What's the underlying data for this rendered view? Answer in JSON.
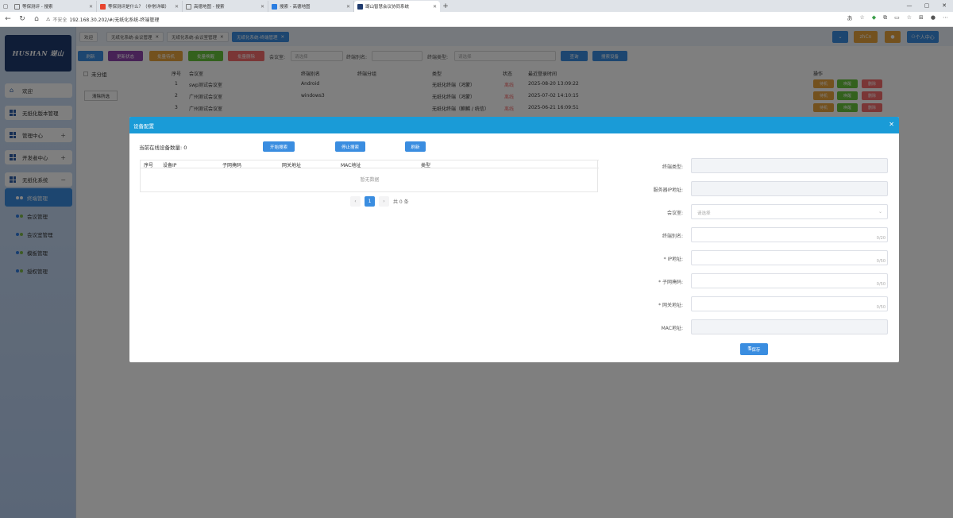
{
  "browser": {
    "tabs": [
      {
        "title": "等保测评 - 搜索"
      },
      {
        "title": "等保测评是什么？（非常详细）"
      },
      {
        "title": "高德地图 - 搜索"
      },
      {
        "title": "搜索 - 高德地图"
      },
      {
        "title": "瑚山智慧会议协同系统"
      }
    ],
    "insecure_label": "不安全",
    "url": "192.168.30.202/#/无纸化系统-终端管理"
  },
  "sidebar": {
    "logo_text": "HUSHAN 瑚山",
    "items": [
      {
        "label": "欢迎"
      },
      {
        "label": "无纸化版本管理"
      },
      {
        "label": "管理中心",
        "toggle": "+"
      },
      {
        "label": "开发者中心",
        "toggle": "+"
      },
      {
        "label": "无纸化系统",
        "toggle": "−"
      }
    ],
    "subitems": [
      {
        "label": "终端管理"
      },
      {
        "label": "会议管理"
      },
      {
        "label": "会议室管理"
      },
      {
        "label": "模板管理"
      },
      {
        "label": "授权管理"
      }
    ]
  },
  "header": {
    "tabs": [
      {
        "label": "欢迎"
      },
      {
        "label": "无纸化系统-会议管理"
      },
      {
        "label": "无纸化系统-会议室管理"
      },
      {
        "label": "无纸化系统-终端管理"
      }
    ],
    "lang": "zhCn",
    "user": "个人中心"
  },
  "toolbar": {
    "refresh": "刷新",
    "update_status": "更新状态",
    "batch_shutdown": "批量待机",
    "batch_wake": "批量唤醒",
    "batch_delete": "批量删除",
    "room_label": "会议室:",
    "room_placeholder": "请选择",
    "alias_label": "终端别名:",
    "type_label": "终端类型:",
    "type_placeholder": "请选择",
    "query": "查询",
    "search_device": "搜索设备"
  },
  "group_panel": {
    "title": "未分组",
    "clear": "清除所选"
  },
  "table": {
    "headers": [
      "序号",
      "会议室",
      "终端别名",
      "终端分组",
      "类型",
      "状态",
      "最近登录时间",
      "操作"
    ],
    "rows": [
      {
        "no": "1",
        "room": "swp测试会议室",
        "alias": "Android",
        "type": "无纸化终端（鸿蒙）",
        "status": "离线",
        "time": "2025-08-20 13:09:22"
      },
      {
        "no": "2",
        "room": "广州测试会议室",
        "alias": "windows3",
        "type": "无纸化终端（鸿蒙）",
        "status": "离线",
        "time": "2025-07-02 14:10:15"
      },
      {
        "no": "3",
        "room": "广州测试会议室",
        "alias": "",
        "type": "无纸化终端（麒麟 / 统信）",
        "status": "离线",
        "time": "2025-06-21 16:09:51"
      }
    ],
    "actions": [
      "待机",
      "唤醒",
      "删除"
    ]
  },
  "modal": {
    "title": "设备配置",
    "online_label": "当前在线设备数量:",
    "online_count": "0",
    "start_search": "开始搜索",
    "stop_search": "停止搜索",
    "refresh": "刷新",
    "device_headers": [
      "序号",
      "设备IP",
      "子网掩码",
      "网关地址",
      "MAC地址",
      "类型"
    ],
    "empty_text": "暂无数据",
    "pager": {
      "prev": "‹",
      "page": "1",
      "next": "›",
      "total": "共 0 条"
    },
    "form": {
      "terminal_type_label": "终端类型:",
      "server_ip_label": "服务器IP地址:",
      "room_label": "会议室:",
      "room_placeholder": "请选择",
      "alias_label": "终端别名:",
      "alias_count": "0/20",
      "ip_label": "* IP地址:",
      "ip_count": "0/50",
      "mask_label": "* 子网掩码:",
      "mask_count": "0/50",
      "gateway_label": "* 网关地址:",
      "gateway_count": "0/50",
      "mac_label": "MAC地址:",
      "save": "保存"
    }
  },
  "colors": {
    "primary": "#3a8de0",
    "modal_header": "#1a9bd7",
    "shutdown": "#e6a23c",
    "wake": "#67c23a",
    "delete": "#f56c6c",
    "update": "#8e44ad"
  }
}
